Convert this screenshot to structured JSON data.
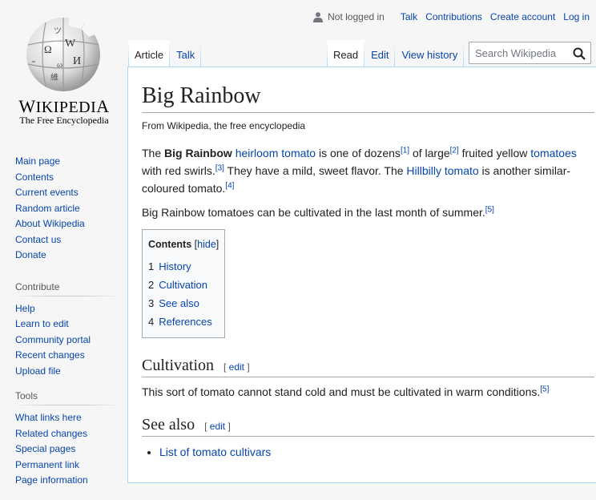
{
  "personal": {
    "not_logged_in": "Not logged in",
    "talk": "Talk",
    "contributions": "Contributions",
    "create_account": "Create account",
    "log_in": "Log in"
  },
  "logo": {
    "wordmark_first": "W",
    "wordmark_small": "IKIPEDI",
    "wordmark_last": "A",
    "tagline": "The Free Encyclopedia"
  },
  "sidebar": {
    "navigation": [
      "Main page",
      "Contents",
      "Current events",
      "Random article",
      "About Wikipedia",
      "Contact us",
      "Donate"
    ],
    "contribute": {
      "heading": "Contribute",
      "items": [
        "Help",
        "Learn to edit",
        "Community portal",
        "Recent changes",
        "Upload file"
      ]
    },
    "tools": {
      "heading": "Tools",
      "items": [
        "What links here",
        "Related changes",
        "Special pages",
        "Permanent link",
        "Page information"
      ]
    }
  },
  "tabs": {
    "article": "Article",
    "talk": "Talk",
    "read": "Read",
    "edit": "Edit",
    "view_history": "View history"
  },
  "search": {
    "placeholder": "Search Wikipedia"
  },
  "article": {
    "title": "Big Rainbow",
    "site_sub": "From Wikipedia, the free encyclopedia",
    "p1": {
      "t1": "The ",
      "bold": "Big Rainbow",
      "t2": " ",
      "link_heirloom": "heirloom tomato",
      "t3": " is one of dozens",
      "ref1": "[1]",
      "t4": " of large",
      "ref2": "[2]",
      "t5": " fruited yellow ",
      "link_tomatoes": "tomatoes",
      "t6": " with red swirls.",
      "ref3": "[3]",
      "t7": " They have a mild, sweet flavor. The ",
      "link_hillbilly": "Hillbilly tomato",
      "t8": " is another similar-coloured tomato.",
      "ref4": "[4]"
    },
    "p2": {
      "text": "Big Rainbow tomatoes can be cultivated in the last month of summer.",
      "ref": "[5]"
    },
    "toc": {
      "title": "Contents",
      "hide_open": "[",
      "hide": "hide",
      "hide_close": "]",
      "items": [
        {
          "num": "1",
          "label": "History"
        },
        {
          "num": "2",
          "label": "Cultivation"
        },
        {
          "num": "3",
          "label": "See also"
        },
        {
          "num": "4",
          "label": "References"
        }
      ]
    },
    "cultivation": {
      "heading": "Cultivation",
      "edit_open": "[ ",
      "edit": "edit",
      "edit_close": " ]",
      "text": "This sort of tomato cannot stand cold and must be cultivated in warm conditions.",
      "ref": "[5]"
    },
    "see_also": {
      "heading": "See also",
      "edit_open": "[ ",
      "edit": "edit",
      "edit_close": " ]",
      "items": [
        "List of tomato cultivars"
      ]
    }
  }
}
